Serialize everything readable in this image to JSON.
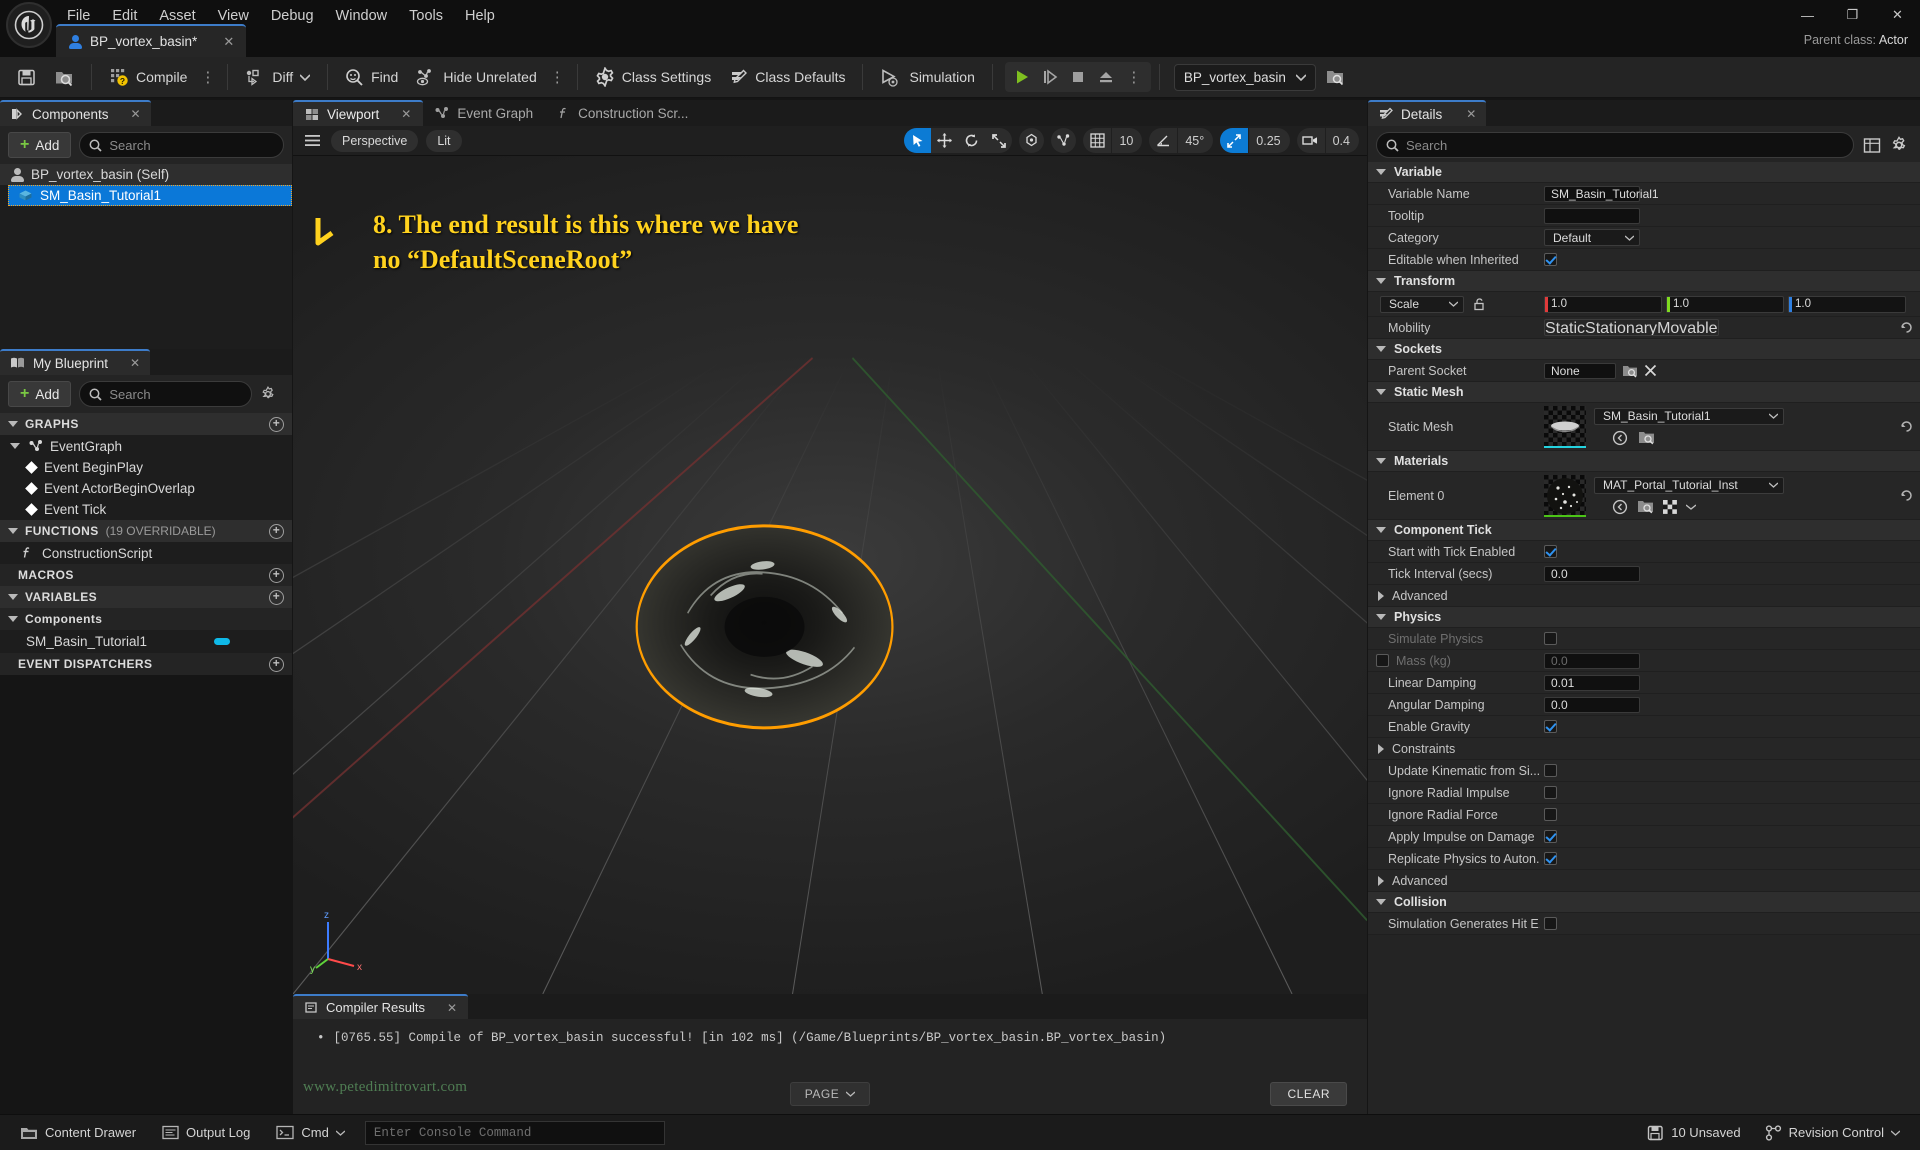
{
  "window": {
    "parent_class_label": "Parent class:",
    "parent_class_value": "Actor",
    "minimize": "—",
    "maximize": "❐",
    "close": "✕"
  },
  "menubar": {
    "items": [
      "File",
      "Edit",
      "Asset",
      "View",
      "Debug",
      "Window",
      "Tools",
      "Help"
    ]
  },
  "doc_tab": {
    "label": "BP_vortex_basin*",
    "close": "✕"
  },
  "toolbar": {
    "save_tip": "Save",
    "browse_tip": "Browse",
    "compile": "Compile",
    "diff": "Diff",
    "find": "Find",
    "hide_unrelated": "Hide Unrelated",
    "class_settings": "Class Settings",
    "class_defaults": "Class Defaults",
    "simulation": "Simulation",
    "blueprint_select": "BP_vortex_basin",
    "dots": "⋮"
  },
  "components_panel": {
    "tab_label": "Components",
    "tab_close": "✕",
    "add_label": "Add",
    "search_placeholder": "Search",
    "items": [
      {
        "label": "BP_vortex_basin (Self)",
        "selected": false,
        "icon": "actor-icon"
      },
      {
        "label": "SM_Basin_Tutorial1",
        "selected": true,
        "icon": "static-mesh-icon"
      }
    ]
  },
  "my_blueprint_panel": {
    "tab_label": "My Blueprint",
    "tab_close": "✕",
    "add_label": "Add",
    "search_placeholder": "Search",
    "sections": {
      "graphs": "GRAPHS",
      "event_graph": "EventGraph",
      "events": [
        "Event BeginPlay",
        "Event ActorBeginOverlap",
        "Event Tick"
      ],
      "functions": "FUNCTIONS",
      "functions_note": "(19 OVERRIDABLE)",
      "construction_script": "ConstructionScript",
      "macros": "MACROS",
      "variables": "VARIABLES",
      "components_group": "Components",
      "component_var": "SM_Basin_Tutorial1",
      "event_dispatchers": "EVENT DISPATCHERS"
    }
  },
  "viewport": {
    "tabs": [
      {
        "label": "Viewport",
        "active": true,
        "close": "✕"
      },
      {
        "label": "Event Graph",
        "active": false
      },
      {
        "label": "Construction Scr...",
        "active": false
      }
    ],
    "perspective": "Perspective",
    "lit": "Lit",
    "grid_snap_value": "10",
    "angle_snap_value": "45°",
    "scale_snap_value": "0.25",
    "camera_speed_value": "0.4",
    "annotation": "8. The end result is this where we have no “DefaultSceneRoot”",
    "annotation_color": "#ffd21e",
    "selection_outline_color": "#ff9d00",
    "axis_labels": [
      "z",
      "y",
      "x"
    ]
  },
  "compiler_results": {
    "tab_label": "Compiler Results",
    "tab_close": "✕",
    "bullet": "•",
    "message": "[0765.55] Compile of BP_vortex_basin successful! [in 102 ms] (/Game/Blueprints/BP_vortex_basin.BP_vortex_basin)",
    "page_label": "PAGE",
    "clear_label": "CLEAR"
  },
  "watermark": "www.petedimitrovart.com",
  "details": {
    "tab_label": "Details",
    "tab_close": "✕",
    "search_placeholder": "Search",
    "categories": [
      {
        "name": "Variable",
        "expanded": true,
        "rows": [
          {
            "label": "Variable Name",
            "type": "text",
            "value": "SM_Basin_Tutorial1"
          },
          {
            "label": "Tooltip",
            "type": "text",
            "value": ""
          },
          {
            "label": "Category",
            "type": "combo",
            "value": "Default"
          },
          {
            "label": "Editable when Inherited",
            "type": "checkbox",
            "value": true
          }
        ]
      },
      {
        "name": "Transform",
        "expanded": true,
        "rows": [
          {
            "label": "",
            "type": "transform",
            "mode": "Scale",
            "x": "1.0",
            "y": "1.0",
            "z": "1.0"
          },
          {
            "label": "Mobility",
            "type": "mobility",
            "options": [
              "Static",
              "Stationary",
              "Movable"
            ],
            "value": "Static",
            "reset": true
          }
        ]
      },
      {
        "name": "Sockets",
        "expanded": true,
        "rows": [
          {
            "label": "Parent Socket",
            "type": "socket",
            "value": "None"
          }
        ]
      },
      {
        "name": "Static Mesh",
        "expanded": true,
        "rows": [
          {
            "label": "Static Mesh",
            "type": "asset",
            "value": "SM_Basin_Tutorial1",
            "bar_color": "#25d3e0",
            "reset": true
          }
        ]
      },
      {
        "name": "Materials",
        "expanded": true,
        "rows": [
          {
            "label": "Element 0",
            "type": "asset",
            "value": "MAT_Portal_Tutorial_Inst",
            "bar_color": "#4cc417",
            "reset": true,
            "extra_icons": true
          }
        ]
      },
      {
        "name": "Component Tick",
        "expanded": true,
        "rows": [
          {
            "label": "Start with Tick Enabled",
            "type": "checkbox",
            "value": true
          },
          {
            "label": "Tick Interval (secs)",
            "type": "text",
            "value": "0.0"
          },
          {
            "label": "Advanced",
            "type": "subgroup",
            "expanded": false
          }
        ]
      },
      {
        "name": "Physics",
        "expanded": true,
        "rows": [
          {
            "label": "Simulate Physics",
            "type": "checkbox",
            "value": false,
            "disabled": true
          },
          {
            "label": "Mass (kg)",
            "type": "text-with-checkbox",
            "value": "0.0",
            "disabled": true
          },
          {
            "label": "Linear Damping",
            "type": "text",
            "value": "0.01"
          },
          {
            "label": "Angular Damping",
            "type": "text",
            "value": "0.0"
          },
          {
            "label": "Enable Gravity",
            "type": "checkbox",
            "value": true
          },
          {
            "label": "Constraints",
            "type": "subgroup",
            "expanded": false
          },
          {
            "label": "Update Kinematic from Si...",
            "type": "checkbox",
            "value": false
          },
          {
            "label": "Ignore Radial Impulse",
            "type": "checkbox",
            "value": false
          },
          {
            "label": "Ignore Radial Force",
            "type": "checkbox",
            "value": false
          },
          {
            "label": "Apply Impulse on Damage",
            "type": "checkbox",
            "value": true
          },
          {
            "label": "Replicate Physics to Auton...",
            "type": "checkbox",
            "value": true
          },
          {
            "label": "Advanced",
            "type": "subgroup",
            "expanded": false
          }
        ]
      },
      {
        "name": "Collision",
        "expanded": true,
        "rows": [
          {
            "label": "Simulation Generates Hit E...",
            "type": "checkbox",
            "value": false
          }
        ]
      }
    ]
  },
  "statusbar": {
    "content_drawer": "Content Drawer",
    "output_log": "Output Log",
    "cmd": "Cmd",
    "console_placeholder": "Enter Console Command",
    "unsaved": "10 Unsaved",
    "revision_control": "Revision Control"
  }
}
